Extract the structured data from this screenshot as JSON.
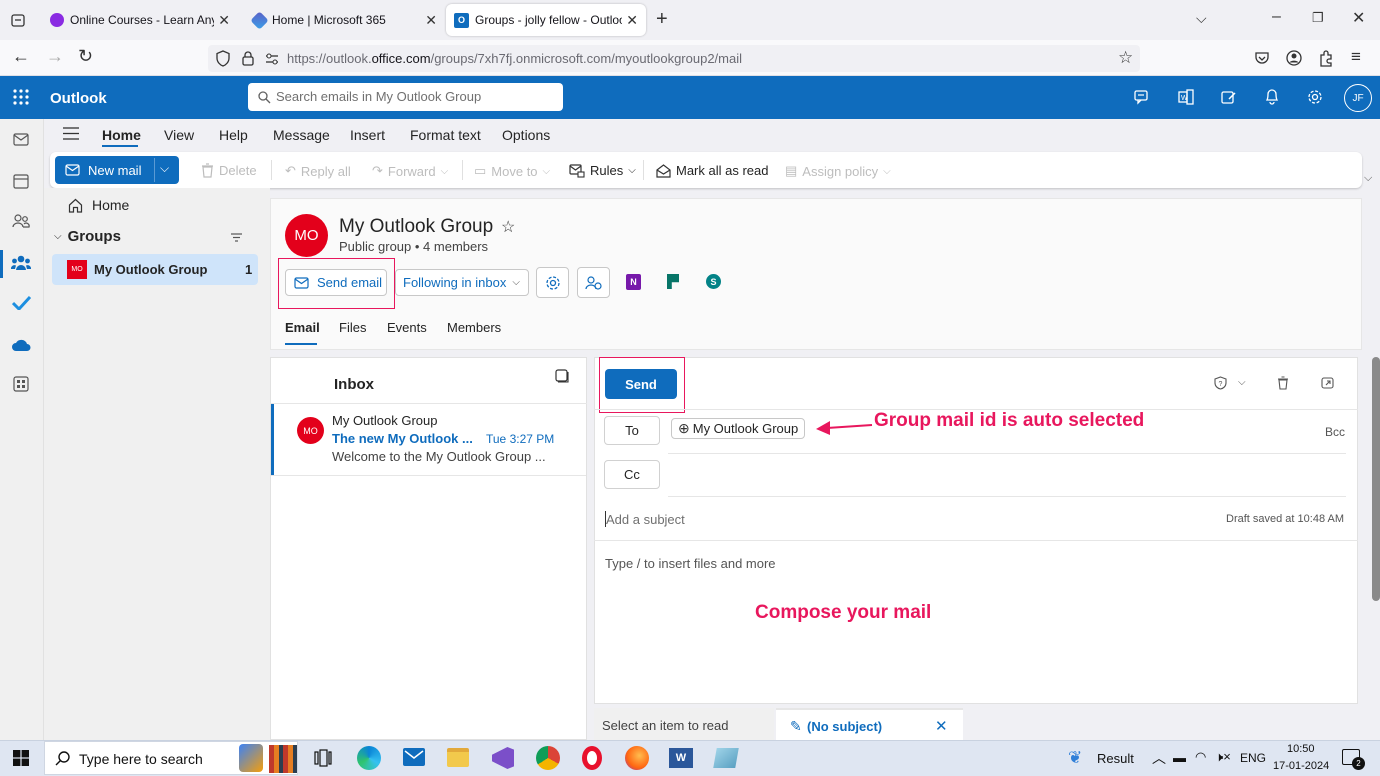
{
  "browser": {
    "tabs": [
      {
        "title": "Online Courses - Learn Anything"
      },
      {
        "title": "Home | Microsoft 365"
      },
      {
        "title": "Groups - jolly fellow - Outlook"
      }
    ],
    "url_prefix": "https://outlook.",
    "url_domain": "office.com",
    "url_path": "/groups/7xh7fj.onmicrosoft.com/myoutlookgroup2/mail"
  },
  "app": {
    "name": "Outlook",
    "search_placeholder": "Search emails in My Outlook Group",
    "avatar_initials": "JF"
  },
  "ribbon": {
    "tabs": [
      "Home",
      "View",
      "Help",
      "Message",
      "Insert",
      "Format text",
      "Options"
    ],
    "new_mail": "New mail",
    "delete": "Delete",
    "reply_all": "Reply all",
    "forward": "Forward",
    "move_to": "Move to",
    "rules": "Rules",
    "mark_all_read": "Mark all as read",
    "assign_policy": "Assign policy"
  },
  "folders": {
    "home": "Home",
    "groups_heading": "Groups",
    "group_item": {
      "badge": "MO",
      "name": "My Outlook Group",
      "count": "1"
    }
  },
  "group": {
    "initials": "MO",
    "name": "My Outlook Group",
    "meta": "Public group • 4 members",
    "send_email": "Send email",
    "following": "Following in inbox",
    "tabs": [
      "Email",
      "Files",
      "Events",
      "Members"
    ]
  },
  "inbox": {
    "title": "Inbox",
    "messages": [
      {
        "initials": "MO",
        "sender": "My Outlook Group",
        "subject": "The new My Outlook ...",
        "time": "Tue 3:27 PM",
        "preview": "Welcome to the My Outlook Group ..."
      }
    ]
  },
  "compose": {
    "send": "Send",
    "to_label": "To",
    "recipient": "My Outlook Group",
    "bcc": "Bcc",
    "cc_label": "Cc",
    "subject_placeholder": "Add a subject",
    "draft_status": "Draft saved at 10:48 AM",
    "body_placeholder": "Type / to insert files and more"
  },
  "annotations": {
    "group_mail": "Group mail id is auto selected",
    "compose": "Compose your mail"
  },
  "bottom_tabs": {
    "select_item": "Select an item to read",
    "draft_tab": "(No subject)"
  },
  "taskbar": {
    "search_placeholder": "Type here to search",
    "weather": "Result",
    "lang": "ENG",
    "time": "10:50",
    "date": "17-01-2024",
    "notif_count": "2"
  },
  "colors": {
    "brand": "#0f6cbd",
    "accent": "#e8175d",
    "group_avatar": "#e3001b"
  }
}
